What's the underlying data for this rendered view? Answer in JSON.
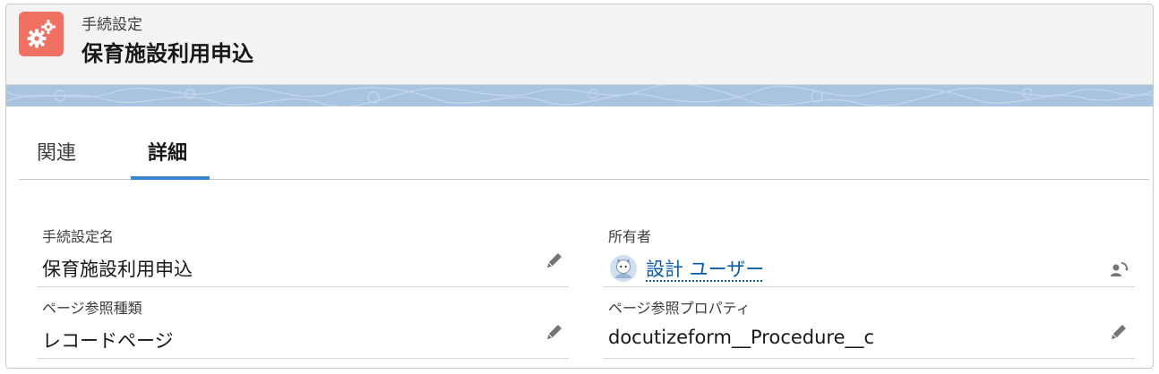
{
  "header": {
    "object_label": "手続設定",
    "record_title": "保育施設利用申込"
  },
  "tabs": [
    {
      "label": "関連",
      "active": false
    },
    {
      "label": "詳細",
      "active": true
    }
  ],
  "fields": {
    "procedure_name": {
      "label": "手続設定名",
      "value": "保育施設利用申込"
    },
    "owner": {
      "label": "所有者",
      "value": "設計 ユーザー"
    },
    "page_ref_type": {
      "label": "ページ参照種類",
      "value": "レコードページ"
    },
    "page_ref_property": {
      "label": "ページ参照プロパティ",
      "value": "docutizeform__Procedure__c"
    }
  },
  "colors": {
    "icon_background": "#f07062",
    "banner": "#a9c4e0",
    "active_tab_indicator": "#3a84d4",
    "link": "#0b5cab"
  },
  "icons": {
    "app": "gears-icon",
    "edit": "pencil-icon",
    "owner_avatar": "astro-avatar",
    "change_owner": "change-owner-icon"
  }
}
